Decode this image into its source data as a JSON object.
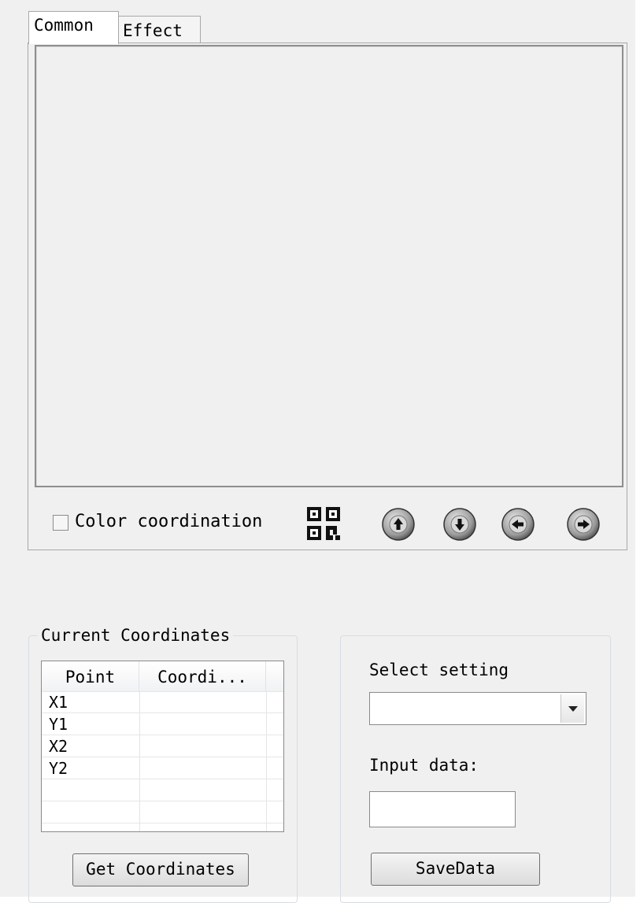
{
  "tabs": {
    "common": "Common",
    "effect": "Effect"
  },
  "toolbar": {
    "color_coordination_label": "Color coordination",
    "color_coordination_checked": false
  },
  "coords_group": {
    "title": "Current Coordinates",
    "columns": [
      "Point",
      "Coordi..."
    ],
    "rows": [
      "X1",
      "Y1",
      "X2",
      "Y2",
      "",
      ""
    ],
    "button": "Get Coordinates"
  },
  "settings_group": {
    "select_label": "Select setting",
    "select_value": "",
    "input_label": "Input data:",
    "input_value": "",
    "button": "SaveData"
  },
  "icons": [
    "qr-code-icon",
    "arrow-up-icon",
    "arrow-down-icon",
    "arrow-left-icon",
    "arrow-right-icon"
  ]
}
